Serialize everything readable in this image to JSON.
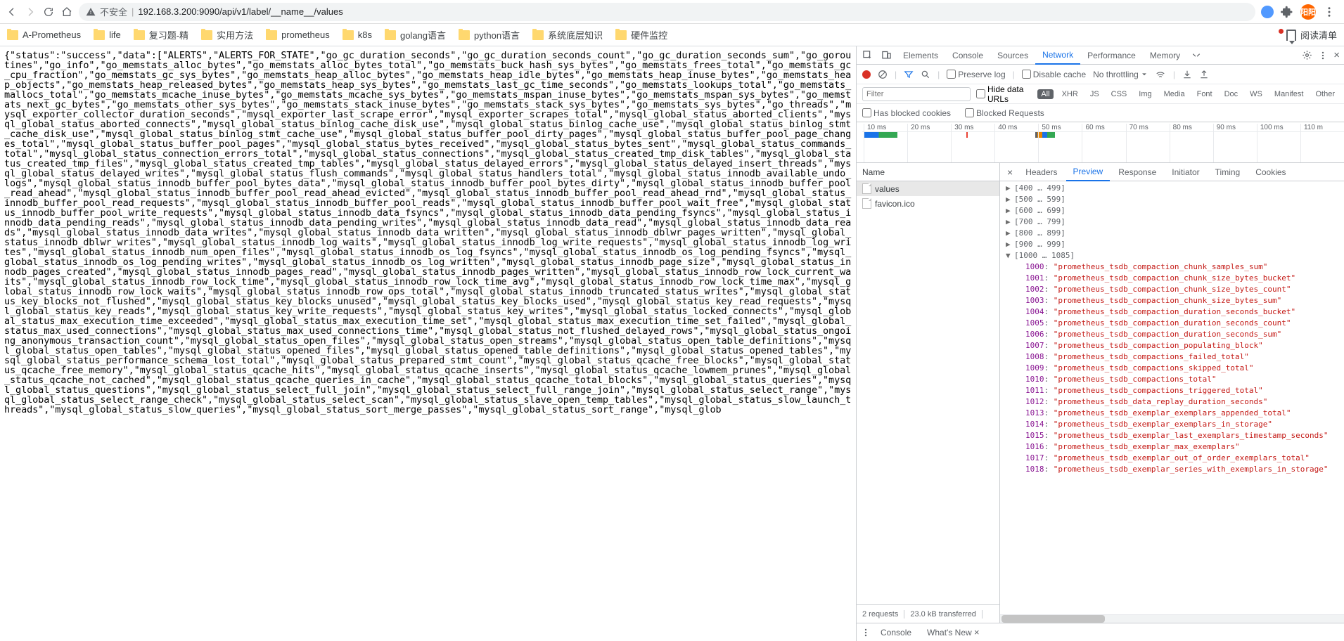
{
  "url": {
    "unsafe_label": "不安全",
    "separator": " | ",
    "display": "192.168.3.200:9090/api/v1/label/__name__/values"
  },
  "toolbar_right": {
    "avatar_text": "阳阳"
  },
  "bookmarks": {
    "items": [
      "A-Prometheus",
      "life",
      "复习题-精",
      "实用方法",
      "prometheus",
      "k8s",
      "golang语言",
      "python语言",
      "系统底层知识",
      "硬件监控"
    ],
    "readlist_label": "阅读清单"
  },
  "page_body_text": "{\"status\":\"success\",\"data\":[\"ALERTS\",\"ALERTS_FOR_STATE\",\"go_gc_duration_seconds\",\"go_gc_duration_seconds_count\",\"go_gc_duration_seconds_sum\",\"go_goroutines\",\"go_info\",\"go_memstats_alloc_bytes\",\"go_memstats_alloc_bytes_total\",\"go_memstats_buck_hash_sys_bytes\",\"go_memstats_frees_total\",\"go_memstats_gc_cpu_fraction\",\"go_memstats_gc_sys_bytes\",\"go_memstats_heap_alloc_bytes\",\"go_memstats_heap_idle_bytes\",\"go_memstats_heap_inuse_bytes\",\"go_memstats_heap_objects\",\"go_memstats_heap_released_bytes\",\"go_memstats_heap_sys_bytes\",\"go_memstats_last_gc_time_seconds\",\"go_memstats_lookups_total\",\"go_memstats_mallocs_total\",\"go_memstats_mcache_inuse_bytes\",\"go_memstats_mcache_sys_bytes\",\"go_memstats_mspan_inuse_bytes\",\"go_memstats_mspan_sys_bytes\",\"go_memstats_next_gc_bytes\",\"go_memstats_other_sys_bytes\",\"go_memstats_stack_inuse_bytes\",\"go_memstats_stack_sys_bytes\",\"go_memstats_sys_bytes\",\"go_threads\",\"mysql_exporter_collector_duration_seconds\",\"mysql_exporter_last_scrape_error\",\"mysql_exporter_scrapes_total\",\"mysql_global_status_aborted_clients\",\"mysql_global_status_aborted_connects\",\"mysql_global_status_binlog_cache_disk_use\",\"mysql_global_status_binlog_cache_use\",\"mysql_global_status_binlog_stmt_cache_disk_use\",\"mysql_global_status_binlog_stmt_cache_use\",\"mysql_global_status_buffer_pool_dirty_pages\",\"mysql_global_status_buffer_pool_page_changes_total\",\"mysql_global_status_buffer_pool_pages\",\"mysql_global_status_bytes_received\",\"mysql_global_status_bytes_sent\",\"mysql_global_status_commands_total\",\"mysql_global_status_connection_errors_total\",\"mysql_global_status_connections\",\"mysql_global_status_created_tmp_disk_tables\",\"mysql_global_status_created_tmp_files\",\"mysql_global_status_created_tmp_tables\",\"mysql_global_status_delayed_errors\",\"mysql_global_status_delayed_insert_threads\",\"mysql_global_status_delayed_writes\",\"mysql_global_status_flush_commands\",\"mysql_global_status_handlers_total\",\"mysql_global_status_innodb_available_undo_logs\",\"mysql_global_status_innodb_buffer_pool_bytes_data\",\"mysql_global_status_innodb_buffer_pool_bytes_dirty\",\"mysql_global_status_innodb_buffer_pool_read_ahead\",\"mysql_global_status_innodb_buffer_pool_read_ahead_evicted\",\"mysql_global_status_innodb_buffer_pool_read_ahead_rnd\",\"mysql_global_status_innodb_buffer_pool_read_requests\",\"mysql_global_status_innodb_buffer_pool_reads\",\"mysql_global_status_innodb_buffer_pool_wait_free\",\"mysql_global_status_innodb_buffer_pool_write_requests\",\"mysql_global_status_innodb_data_fsyncs\",\"mysql_global_status_innodb_data_pending_fsyncs\",\"mysql_global_status_innodb_data_pending_reads\",\"mysql_global_status_innodb_data_pending_writes\",\"mysql_global_status_innodb_data_read\",\"mysql_global_status_innodb_data_reads\",\"mysql_global_status_innodb_data_writes\",\"mysql_global_status_innodb_data_written\",\"mysql_global_status_innodb_dblwr_pages_written\",\"mysql_global_status_innodb_dblwr_writes\",\"mysql_global_status_innodb_log_waits\",\"mysql_global_status_innodb_log_write_requests\",\"mysql_global_status_innodb_log_writes\",\"mysql_global_status_innodb_num_open_files\",\"mysql_global_status_innodb_os_log_fsyncs\",\"mysql_global_status_innodb_os_log_pending_fsyncs\",\"mysql_global_status_innodb_os_log_pending_writes\",\"mysql_global_status_innodb_os_log_written\",\"mysql_global_status_innodb_page_size\",\"mysql_global_status_innodb_pages_created\",\"mysql_global_status_innodb_pages_read\",\"mysql_global_status_innodb_pages_written\",\"mysql_global_status_innodb_row_lock_current_waits\",\"mysql_global_status_innodb_row_lock_time\",\"mysql_global_status_innodb_row_lock_time_avg\",\"mysql_global_status_innodb_row_lock_time_max\",\"mysql_global_status_innodb_row_lock_waits\",\"mysql_global_status_innodb_row_ops_total\",\"mysql_global_status_innodb_truncated_status_writes\",\"mysql_global_status_key_blocks_not_flushed\",\"mysql_global_status_key_blocks_unused\",\"mysql_global_status_key_blocks_used\",\"mysql_global_status_key_read_requests\",\"mysql_global_status_key_reads\",\"mysql_global_status_key_write_requests\",\"mysql_global_status_key_writes\",\"mysql_global_status_locked_connects\",\"mysql_global_status_max_execution_time_exceeded\",\"mysql_global_status_max_execution_time_set\",\"mysql_global_status_max_execution_time_set_failed\",\"mysql_global_status_max_used_connections\",\"mysql_global_status_max_used_connections_time\",\"mysql_global_status_not_flushed_delayed_rows\",\"mysql_global_status_ongoing_anonymous_transaction_count\",\"mysql_global_status_open_files\",\"mysql_global_status_open_streams\",\"mysql_global_status_open_table_definitions\",\"mysql_global_status_open_tables\",\"mysql_global_status_opened_files\",\"mysql_global_status_opened_table_definitions\",\"mysql_global_status_opened_tables\",\"mysql_global_status_performance_schema_lost_total\",\"mysql_global_status_prepared_stmt_count\",\"mysql_global_status_qcache_free_blocks\",\"mysql_global_status_qcache_free_memory\",\"mysql_global_status_qcache_hits\",\"mysql_global_status_qcache_inserts\",\"mysql_global_status_qcache_lowmem_prunes\",\"mysql_global_status_qcache_not_cached\",\"mysql_global_status_qcache_queries_in_cache\",\"mysql_global_status_qcache_total_blocks\",\"mysql_global_status_queries\",\"mysql_global_status_questions\",\"mysql_global_status_select_full_join\",\"mysql_global_status_select_full_range_join\",\"mysql_global_status_select_range\",\"mysql_global_status_select_range_check\",\"mysql_global_status_select_scan\",\"mysql_global_status_slave_open_temp_tables\",\"mysql_global_status_slow_launch_threads\",\"mysql_global_status_slow_queries\",\"mysql_global_status_sort_merge_passes\",\"mysql_global_status_sort_range\",\"mysql_glob",
  "devtools": {
    "main_tabs": [
      "Elements",
      "Console",
      "Sources",
      "Network",
      "Performance",
      "Memory"
    ],
    "main_active_index": 3,
    "network_bar1": {
      "preserve_log": "Preserve log",
      "disable_cache": "Disable cache",
      "throttling": "No throttling"
    },
    "network_bar2": {
      "filter_placeholder": "Filter",
      "hide_data_urls": "Hide data URLs",
      "types": [
        "All",
        "XHR",
        "JS",
        "CSS",
        "Img",
        "Media",
        "Font",
        "Doc",
        "WS",
        "Manifest",
        "Other"
      ],
      "type_active_index": 0
    },
    "network_bar3": {
      "blocked_cookies": "Has blocked cookies",
      "blocked_requests": "Blocked Requests"
    },
    "timeline_ticks": [
      "10 ms",
      "20 ms",
      "30 ms",
      "40 ms",
      "50 ms",
      "60 ms",
      "70 ms",
      "80 ms",
      "90 ms",
      "100 ms",
      "110 m"
    ],
    "requests": {
      "header": "Name",
      "rows": [
        {
          "name": "values",
          "selected": true
        },
        {
          "name": "favicon.ico",
          "selected": false
        }
      ],
      "footer_left": "2 requests",
      "footer_right": "23.0 kB transferred"
    },
    "detail_tabs": [
      "Headers",
      "Preview",
      "Response",
      "Initiator",
      "Timing",
      "Cookies"
    ],
    "detail_active_index": 1,
    "preview_tree": {
      "collapsed_ranges": [
        "[400 … 499]",
        "[500 … 599]",
        "[600 … 699]",
        "[700 … 799]",
        "[800 … 899]",
        "[900 … 999]"
      ],
      "open_range": "[1000 … 1085]",
      "items": [
        {
          "idx": "1000",
          "val": "\"prometheus_tsdb_compaction_chunk_samples_sum\""
        },
        {
          "idx": "1001",
          "val": "\"prometheus_tsdb_compaction_chunk_size_bytes_bucket\""
        },
        {
          "idx": "1002",
          "val": "\"prometheus_tsdb_compaction_chunk_size_bytes_count\""
        },
        {
          "idx": "1003",
          "val": "\"prometheus_tsdb_compaction_chunk_size_bytes_sum\""
        },
        {
          "idx": "1004",
          "val": "\"prometheus_tsdb_compaction_duration_seconds_bucket\""
        },
        {
          "idx": "1005",
          "val": "\"prometheus_tsdb_compaction_duration_seconds_count\""
        },
        {
          "idx": "1006",
          "val": "\"prometheus_tsdb_compaction_duration_seconds_sum\""
        },
        {
          "idx": "1007",
          "val": "\"prometheus_tsdb_compaction_populating_block\""
        },
        {
          "idx": "1008",
          "val": "\"prometheus_tsdb_compactions_failed_total\""
        },
        {
          "idx": "1009",
          "val": "\"prometheus_tsdb_compactions_skipped_total\""
        },
        {
          "idx": "1010",
          "val": "\"prometheus_tsdb_compactions_total\""
        },
        {
          "idx": "1011",
          "val": "\"prometheus_tsdb_compactions_triggered_total\""
        },
        {
          "idx": "1012",
          "val": "\"prometheus_tsdb_data_replay_duration_seconds\""
        },
        {
          "idx": "1013",
          "val": "\"prometheus_tsdb_exemplar_exemplars_appended_total\""
        },
        {
          "idx": "1014",
          "val": "\"prometheus_tsdb_exemplar_exemplars_in_storage\""
        },
        {
          "idx": "1015",
          "val": "\"prometheus_tsdb_exemplar_last_exemplars_timestamp_seconds\""
        },
        {
          "idx": "1016",
          "val": "\"prometheus_tsdb_exemplar_max_exemplars\""
        },
        {
          "idx": "1017",
          "val": "\"prometheus_tsdb_exemplar_out_of_order_exemplars_total\""
        },
        {
          "idx": "1018",
          "val": "\"prometheus_tsdb_exemplar_series_with_exemplars_in_storage\""
        }
      ]
    },
    "drawer_tabs": [
      "Console",
      "What's New"
    ]
  }
}
